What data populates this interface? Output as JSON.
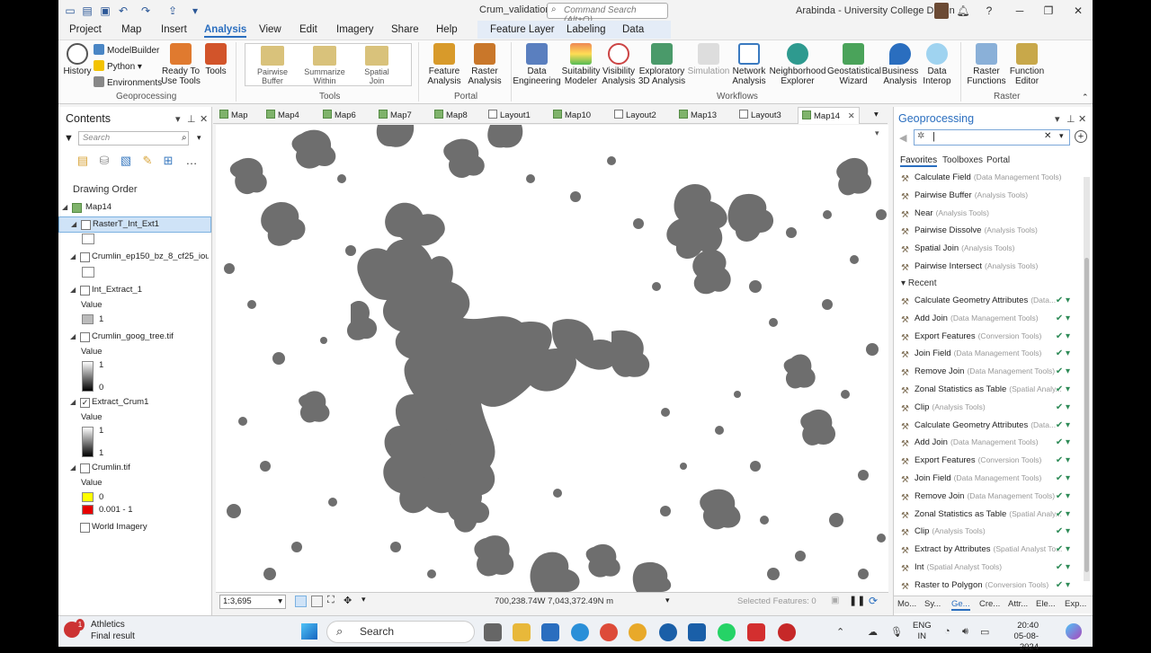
{
  "titlebar": {
    "doc_title": "Crum_validation",
    "command_search_placeholder": "Command Search (Alt+Q)",
    "user": "Arabinda - University College Dublin"
  },
  "menu_tabs": [
    "Project",
    "Map",
    "Insert",
    "Analysis",
    "View",
    "Edit",
    "Imagery",
    "Share",
    "Help",
    "Feature Layer",
    "Labeling",
    "Data"
  ],
  "active_menu_tab": "Analysis",
  "ribbon": {
    "geoprocessing": {
      "label": "Geoprocessing",
      "history": "History",
      "modelbuilder": "ModelBuilder",
      "python": "Python",
      "environments": "Environments",
      "ready_tools_1": "Ready To",
      "ready_tools_2": "Use Tools",
      "tools": "Tools"
    },
    "tools_group": {
      "label": "Tools",
      "items": [
        {
          "l1": "Pairwise",
          "l2": "Buffer"
        },
        {
          "l1": "Summarize",
          "l2": "Within"
        },
        {
          "l1": "Spatial",
          "l2": "Join"
        }
      ]
    },
    "portal": {
      "label": "Portal",
      "feature_1": "Feature",
      "feature_2": "Analysis",
      "raster_1": "Raster",
      "raster_2": "Analysis"
    },
    "workflows": {
      "label": "Workflows",
      "items": [
        {
          "l1": "Data",
          "l2": "Engineering"
        },
        {
          "l1": "Suitability",
          "l2": "Modeler"
        },
        {
          "l1": "Visibility",
          "l2": "Analysis"
        },
        {
          "l1": "Exploratory",
          "l2": "3D Analysis"
        },
        {
          "l1": "Simulation",
          "l2": ""
        },
        {
          "l1": "Network",
          "l2": "Analysis"
        },
        {
          "l1": "Neighborhood",
          "l2": "Explorer"
        },
        {
          "l1": "Geostatistical",
          "l2": "Wizard"
        },
        {
          "l1": "Business",
          "l2": "Analysis"
        },
        {
          "l1": "Data",
          "l2": "Interop"
        }
      ]
    },
    "raster": {
      "label": "Raster",
      "functions_1": "Raster",
      "functions_2": "Functions",
      "editor_1": "Function",
      "editor_2": "Editor"
    }
  },
  "contents": {
    "title": "Contents",
    "search_placeholder": "Search",
    "drawing_order": "Drawing Order",
    "map_name": "Map14",
    "layers": [
      {
        "name": "RasterT_Int_Ext1",
        "checked": false
      },
      {
        "name": "Crumlin_ep150_bz_8_cf25_iou0...",
        "checked": false
      },
      {
        "name": "Int_Extract_1",
        "checked": false
      },
      {
        "name": "Crumlin_goog_tree.tif",
        "checked": false
      },
      {
        "name": "Extract_Crum1",
        "checked": true
      },
      {
        "name": "Crumlin.tif",
        "checked": false
      },
      {
        "name": "World Imagery",
        "checked": false
      }
    ],
    "legend": {
      "value_label": "Value",
      "int_extract_value": "1",
      "goog_high": "1",
      "goog_low": "0",
      "extract_high": "1",
      "extract_low": "1",
      "crumlin_0": "0",
      "crumlin_1": "0.001 - 1"
    }
  },
  "map_tabs": [
    "Map",
    "Map4",
    "Map6",
    "Map7",
    "Map8",
    "Layout1",
    "Map10",
    "Layout2",
    "Map13",
    "Layout3",
    "Map14"
  ],
  "active_map_tab": "Map14",
  "map_status": {
    "scale": "1:3,695",
    "coords": "700,238.74W 7,043,372.49N m",
    "selected": "Selected Features: 0"
  },
  "geoprocessing": {
    "title": "Geoprocessing",
    "tabs": [
      "Favorites",
      "Toolboxes",
      "Portal"
    ],
    "favorites": [
      {
        "name": "Calculate Field",
        "box": "(Data Management Tools)"
      },
      {
        "name": "Pairwise Buffer",
        "box": "(Analysis Tools)"
      },
      {
        "name": "Near",
        "box": "(Analysis Tools)"
      },
      {
        "name": "Pairwise Dissolve",
        "box": "(Analysis Tools)"
      },
      {
        "name": "Spatial Join",
        "box": "(Analysis Tools)"
      },
      {
        "name": "Pairwise Intersect",
        "box": "(Analysis Tools)"
      }
    ],
    "recent_label": "Recent",
    "recent": [
      {
        "name": "Calculate Geometry Attributes",
        "box": "(Data..."
      },
      {
        "name": "Add Join",
        "box": "(Data Management Tools)"
      },
      {
        "name": "Export Features",
        "box": "(Conversion Tools)"
      },
      {
        "name": "Join Field",
        "box": "(Data Management Tools)"
      },
      {
        "name": "Remove Join",
        "box": "(Data Management Tools)"
      },
      {
        "name": "Zonal Statistics as Table",
        "box": "(Spatial Analy..."
      },
      {
        "name": "Clip",
        "box": "(Analysis Tools)"
      },
      {
        "name": "Calculate Geometry Attributes",
        "box": "(Data..."
      },
      {
        "name": "Add Join",
        "box": "(Data Management Tools)"
      },
      {
        "name": "Export Features",
        "box": "(Conversion Tools)"
      },
      {
        "name": "Join Field",
        "box": "(Data Management Tools)"
      },
      {
        "name": "Remove Join",
        "box": "(Data Management Tools)"
      },
      {
        "name": "Zonal Statistics as Table",
        "box": "(Spatial Analy..."
      },
      {
        "name": "Clip",
        "box": "(Analysis Tools)"
      },
      {
        "name": "Extract by Attributes",
        "box": "(Spatial Analyst To..."
      },
      {
        "name": "Int",
        "box": "(Spatial Analyst Tools)"
      },
      {
        "name": "Raster to Polygon",
        "box": "(Conversion Tools)"
      }
    ],
    "bottom_tabs": [
      "Mo...",
      "Sy...",
      "Ge...",
      "Cre...",
      "Attr...",
      "Ele...",
      "Exp..."
    ]
  },
  "taskbar": {
    "notify_title": "Athletics",
    "notify_sub": "Final result",
    "notify_badge": "1",
    "search": "Search",
    "lang_1": "ENG",
    "lang_2": "IN",
    "time": "20:40",
    "date": "05-08-2024"
  },
  "colors": {
    "accent": "#2a6ebf",
    "map_feature": "#6e6e6e",
    "legend_yellow": "#ffff00",
    "legend_red": "#e60000"
  }
}
